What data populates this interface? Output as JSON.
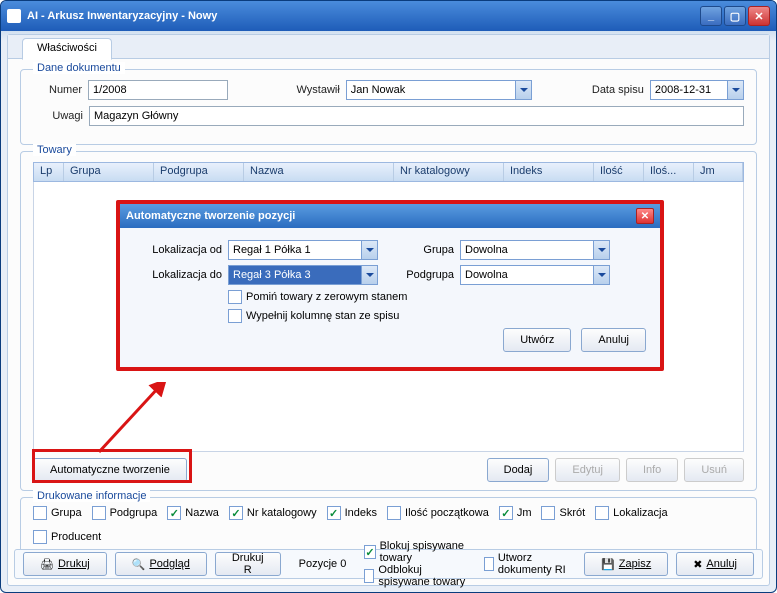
{
  "window": {
    "title": "AI - Arkusz Inwentaryzacyjny - Nowy"
  },
  "tab": {
    "label": "Właściwości"
  },
  "doc": {
    "legend": "Dane dokumentu",
    "numer_label": "Numer",
    "numer": "1/2008",
    "wystawil_label": "Wystawił",
    "wystawil": "Jan Nowak",
    "data_label": "Data spisu",
    "data": "2008-12-31",
    "uwagi_label": "Uwagi",
    "uwagi": "Magazyn Główny"
  },
  "towary": {
    "legend": "Towary",
    "cols": {
      "lp": "Lp",
      "grupa": "Grupa",
      "podgrupa": "Podgrupa",
      "nazwa": "Nazwa",
      "nrk": "Nr katalogowy",
      "indeks": "Indeks",
      "ilosc": "Ilość",
      "ilosc2": "Iloś...",
      "jm": "Jm"
    },
    "auto_btn": "Automatyczne tworzenie",
    "dodaj": "Dodaj",
    "edytuj": "Edytuj",
    "info": "Info",
    "usun": "Usuń"
  },
  "dialog": {
    "title": "Automatyczne tworzenie pozycji",
    "lok_od_label": "Lokalizacja od",
    "lok_od": "Regał 1 Półka 1",
    "lok_do_label": "Lokalizacja do",
    "lok_do": "Regał 3 Półka 3",
    "grupa_label": "Grupa",
    "grupa": "Dowolna",
    "podgrupa_label": "Podgrupa",
    "podgrupa": "Dowolna",
    "pomin": "Pomiń towary z zerowym stanem",
    "wypelnij": "Wypełnij kolumnę stan ze spisu",
    "utworz": "Utwórz",
    "anuluj": "Anuluj"
  },
  "druk": {
    "legend": "Drukowane informacje",
    "grupa": "Grupa",
    "podgrupa": "Podgrupa",
    "nazwa": "Nazwa",
    "nrk": "Nr katalogowy",
    "indeks": "Indeks",
    "ilosc_p": "Ilość początkowa",
    "jm": "Jm",
    "skrot": "Skrót",
    "lokalizacja": "Lokalizacja",
    "producent": "Producent"
  },
  "footer": {
    "drukuj": "Drukuj",
    "podglad": "Podgląd",
    "drukujR": "Drukuj R",
    "pozycje_label": "Pozycje",
    "pozycje": "0",
    "blokuj": "Blokuj spisywane towary",
    "odblokuj": "Odblokuj spisywane towary",
    "utworzRI": "Utworz dokumenty RI",
    "zapisz": "Zapisz",
    "anuluj": "Anuluj"
  }
}
